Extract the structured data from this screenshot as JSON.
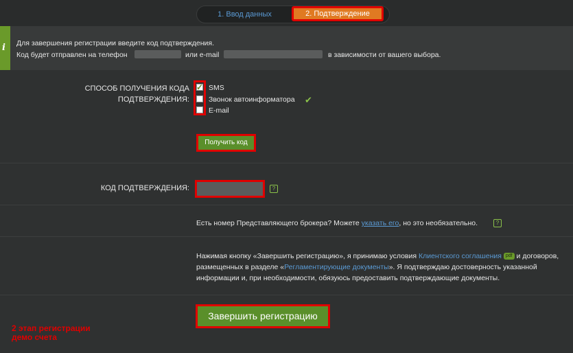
{
  "steps": {
    "step1": "1. Ввод данных",
    "step2": "2. Подтверждение"
  },
  "info": {
    "icon": "i",
    "line1": "Для завершения регистрации введите код подтверждения.",
    "line2_prefix": "Код будет отправлен на телефон",
    "line2_middle": "или e-mail",
    "line2_suffix": "в зависимости от вашего выбора."
  },
  "method": {
    "label_line1": "СПОСОБ ПОЛУЧЕНИЯ КОДА",
    "label_line2": "ПОДТВЕРЖДЕНИЯ:",
    "options": [
      "SMS",
      "Звонок автоинформатора",
      "E-mail"
    ]
  },
  "get_code_button": "Получить код",
  "code_label": "КОД ПОДТВЕРЖДЕНИЯ:",
  "broker": {
    "prefix": "Есть номер Представляющего брокера? Можете",
    "link": "указать его",
    "suffix": ", но это необязательно."
  },
  "terms": {
    "p1": "Нажимая кнопку «Завершить регистрацию», я принимаю условия",
    "link1": "Клиентского соглашения",
    "badge": "pdf",
    "p1b": "и договоров,",
    "p2": "размещенных в разделе «",
    "link2": "Регламентирующие документы",
    "p2b": "». Я подтверждаю достоверность указанной",
    "p3": "информации и, при необходимости, обязуюсь предоставить подтверждающие документы."
  },
  "finish_button": "Завершить регистрацию",
  "annotation": {
    "line1": "2 этап регистрации",
    "line2": "демо счета"
  },
  "colors": {
    "accent_green": "#5a8f2a",
    "highlight_red": "#e00000",
    "active_tab": "#e07a22",
    "link_blue": "#5b9bd5"
  }
}
